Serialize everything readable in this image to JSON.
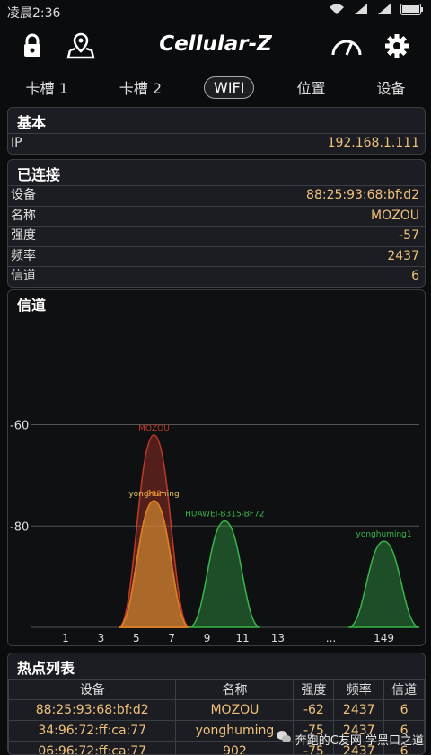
{
  "status": {
    "time": "凌晨2:36"
  },
  "app": {
    "title": "Cellular-Z"
  },
  "tabs": [
    "卡槽 1",
    "卡槽 2",
    "WIFI",
    "位置",
    "设备"
  ],
  "basic": {
    "title": "基本",
    "ip_label": "IP",
    "ip_value": "192.168.1.111"
  },
  "connected": {
    "title": "已连接",
    "rows": [
      {
        "k": "设备",
        "v": "88:25:93:68:bf:d2"
      },
      {
        "k": "名称",
        "v": "MOZOU"
      },
      {
        "k": "强度",
        "v": "-57"
      },
      {
        "k": "频率",
        "v": "2437"
      },
      {
        "k": "信道",
        "v": "6"
      }
    ]
  },
  "channel_card": {
    "title": "信道"
  },
  "chart_data": {
    "type": "area",
    "title": "信道",
    "y_ticks": [
      "-60",
      "-80"
    ],
    "x_ticks": [
      "1",
      "3",
      "5",
      "7",
      "9",
      "11",
      "13",
      "...",
      "149"
    ],
    "ylim": [
      -100,
      -45
    ],
    "series": [
      {
        "name": "MOZOU",
        "channel": 6,
        "x_pos": 5.5,
        "value": -62,
        "color": "#c0392b"
      },
      {
        "name": "yonghuming",
        "channel": 6,
        "x_pos": 5.5,
        "value": -75,
        "color": "#e6c35a"
      },
      {
        "name": "902",
        "channel": 6,
        "x_pos": 5.5,
        "value": -75,
        "color": "#e07b1c"
      },
      {
        "name": "HUAWEI-B315-BF72",
        "channel": 10,
        "x_pos": 9.5,
        "value": -79,
        "color": "#38b54a"
      },
      {
        "name": "yonghuming1",
        "channel": 149,
        "x_pos": 15,
        "value": -83,
        "color": "#38b54a"
      }
    ]
  },
  "hotspots": {
    "title": "热点列表",
    "headers": [
      "设备",
      "名称",
      "强度",
      "频率",
      "信道"
    ],
    "rows": [
      [
        "88:25:93:68:bf:d2",
        "MOZOU",
        "-62",
        "2437",
        "6"
      ],
      [
        "34:96:72:ff:ca:77",
        "yonghuming",
        "-75",
        "2437",
        "6"
      ],
      [
        "06:96:72:ff:ca:77",
        "902",
        "-75",
        "2437",
        "6"
      ]
    ]
  },
  "watermark": "奔跑的C友网 学黑口之道"
}
